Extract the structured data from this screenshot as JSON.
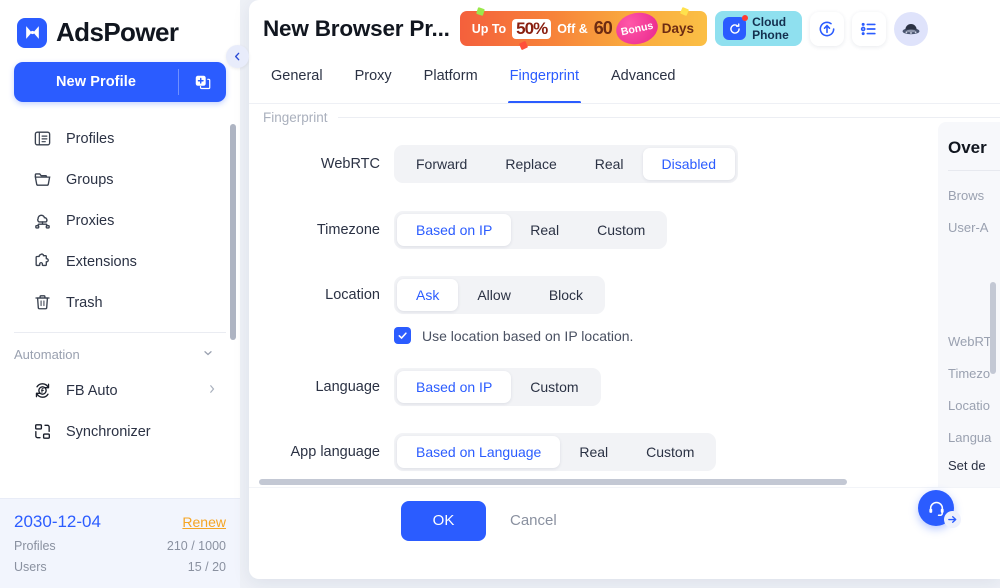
{
  "app": {
    "brand": "AdsPower",
    "brand_icon": "adspower-logo-icon"
  },
  "sidebar": {
    "new_profile_label": "New Profile",
    "new_profile_add_icon": "add-square-icon",
    "collapse_icon": "chevron-left-icon",
    "items": [
      {
        "label": "Profiles",
        "icon": "profiles-icon"
      },
      {
        "label": "Groups",
        "icon": "folder-icon"
      },
      {
        "label": "Proxies",
        "icon": "proxy-network-icon"
      },
      {
        "label": "Extensions",
        "icon": "puzzle-piece-icon"
      },
      {
        "label": "Trash",
        "icon": "trash-icon"
      }
    ],
    "automation": {
      "label": "Automation",
      "chevron_icon": "chevron-down-icon",
      "items": [
        {
          "label": "FB Auto",
          "icon": "fb-auto-icon",
          "arrow_icon": "chevron-right-icon"
        },
        {
          "label": "Synchronizer",
          "icon": "synchronizer-icon"
        }
      ]
    },
    "license": {
      "expiry_date": "2030-12-04",
      "renew_label": "Renew",
      "rows": [
        {
          "label": "Profiles",
          "value": "210 / 1000"
        },
        {
          "label": "Users",
          "value": "15 / 20"
        }
      ]
    }
  },
  "header": {
    "title": "New Browser Pr...",
    "promo": {
      "up_to": "Up To",
      "percent": "50%",
      "off": "Off &",
      "days_number": "60",
      "bonus": "Bonus",
      "days": "Days"
    },
    "cloud_phone": {
      "line1": "Cloud",
      "line2": "Phone",
      "icon": "cloud-phone-icon"
    },
    "icons": [
      {
        "name": "refresh-update-icon"
      },
      {
        "name": "task-list-icon"
      }
    ],
    "avatar_icon": "ufo-avatar-icon"
  },
  "tabs": [
    {
      "label": "General",
      "active": false
    },
    {
      "label": "Proxy",
      "active": false
    },
    {
      "label": "Platform",
      "active": false
    },
    {
      "label": "Fingerprint",
      "active": true
    },
    {
      "label": "Advanced",
      "active": false
    }
  ],
  "form": {
    "section_title": "Fingerprint",
    "rows": [
      {
        "label": "WebRTC",
        "options": [
          "Forward",
          "Replace",
          "Real",
          "Disabled"
        ],
        "selected": "Disabled"
      },
      {
        "label": "Timezone",
        "options": [
          "Based on IP",
          "Real",
          "Custom"
        ],
        "selected": "Based on IP"
      },
      {
        "label": "Location",
        "options": [
          "Ask",
          "Allow",
          "Block"
        ],
        "selected": "Ask"
      },
      {
        "label": "Language",
        "options": [
          "Based on IP",
          "Custom"
        ],
        "selected": "Based on IP"
      },
      {
        "label": "App language",
        "options": [
          "Based on Language",
          "Real",
          "Custom"
        ],
        "selected": "Based on Language"
      }
    ],
    "location_checkbox": {
      "label": "Use location based on IP location.",
      "checked": true,
      "check_icon": "checkmark-icon"
    }
  },
  "overview": {
    "title": "Over",
    "items": [
      "Brows",
      "User-A"
    ],
    "items2": [
      "WebRT",
      "Timezo",
      "Locatio",
      "Langua"
    ],
    "set_default": "Set de"
  },
  "footer": {
    "ok_label": "OK",
    "cancel_label": "Cancel"
  },
  "support": {
    "icon": "headset-support-icon",
    "arrow_icon": "arrow-right-icon"
  },
  "colors": {
    "accent": "#2b5cff",
    "renew": "#f5a524",
    "promo_start": "#f4603c",
    "promo_end": "#fbbf45",
    "cloud_phone_bg": "#8fe0ef",
    "seg_track": "#f2f3f6"
  }
}
